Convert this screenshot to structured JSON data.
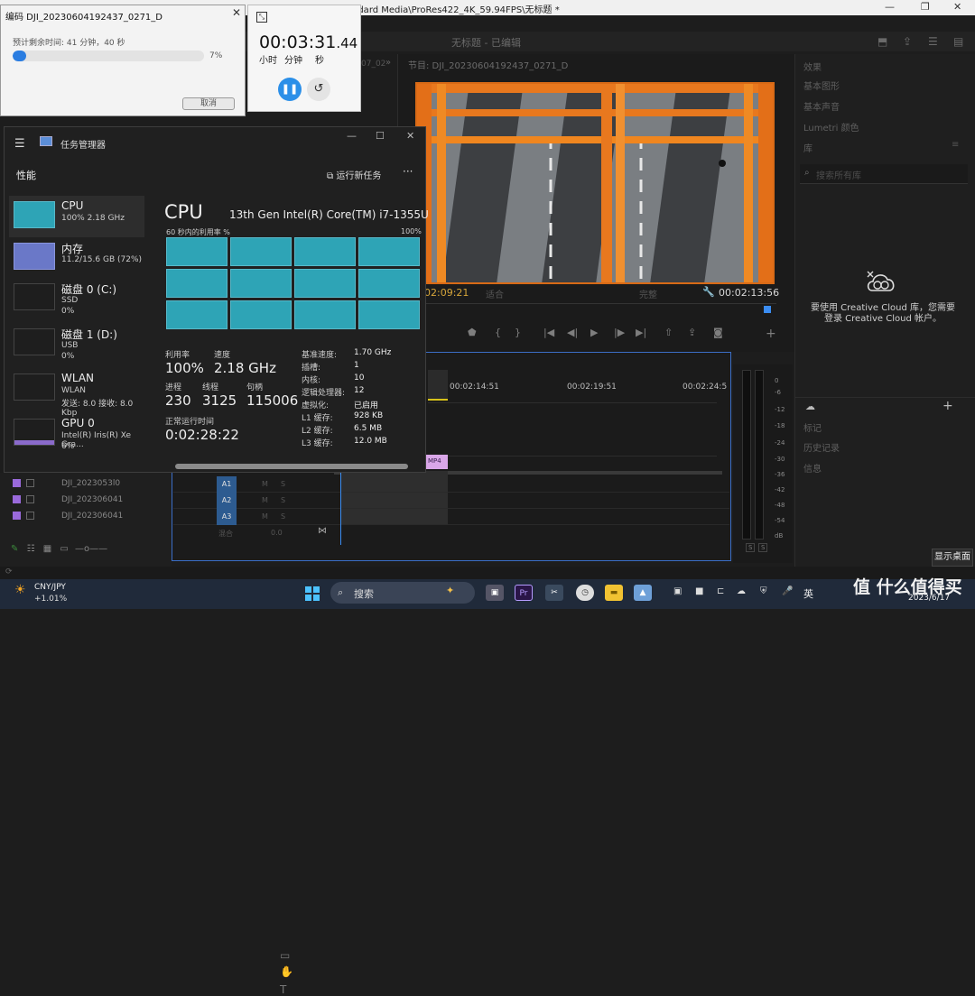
{
  "premiere": {
    "window_title": "ndard Media\\ProRes422_4K_59.94FPS\\无标题 *",
    "header_center": "无标题 - 已编辑",
    "source_label": "07_02",
    "program_label": "节目: DJI_20230604192437_0271_D",
    "timecode_left": "02:09:21",
    "timecode_right": "00:02:13:56",
    "fit_label": "适合",
    "full_label": "完整",
    "ruler": [
      "00:02:14:51",
      "00:02:19:51",
      "00:02:24:5"
    ],
    "clip_label": "MP4",
    "tracks": [
      {
        "label": "A1",
        "m": "M",
        "s": "S"
      },
      {
        "label": "A2",
        "m": "M",
        "s": "S"
      },
      {
        "label": "A3",
        "m": "M",
        "s": "S"
      }
    ],
    "mix_label": "混合",
    "mix_value": "0.0",
    "meter_scale": [
      "0",
      "-6",
      "-12",
      "-18",
      "-24",
      "-30",
      "-36",
      "-42",
      "-48",
      "-54",
      "dB"
    ],
    "meter_s": [
      "S",
      "S"
    ],
    "project_items": [
      "DJI_2023053l0",
      "DJI_202306041",
      "DJI_202306041"
    ],
    "right_panel": {
      "items": [
        "效果",
        "基本图形",
        "基本声音",
        "Lumetri 颜色",
        "库"
      ],
      "search_placeholder": "搜索所有库",
      "cc_message": "要使用 Creative Cloud 库，您需要登录 Creative Cloud 帐户。",
      "lower_items": [
        "标记",
        "历史记录",
        "信息"
      ]
    },
    "show_desktop": "显示桌面"
  },
  "encode": {
    "title": "编码 DJI_20230604192437_0271_D",
    "remaining": "预计剩余时间: 41 分钟，40 秒",
    "progress_pct": 7,
    "pct_label": "7%",
    "cancel": "取消"
  },
  "stopwatch": {
    "time": "00:03:31",
    "ms": ".44",
    "units": [
      "小时",
      "分钟",
      "秒"
    ]
  },
  "taskmgr": {
    "title": "任务管理器",
    "section": "性能",
    "run_task": "运行新任务",
    "sidebar": [
      {
        "name": "CPU",
        "sub1": "100%  2.18 GHz",
        "sub2": ""
      },
      {
        "name": "内存",
        "sub1": "11.2/15.6 GB (72%)",
        "sub2": ""
      },
      {
        "name": "磁盘 0 (C:)",
        "sub1": "SSD",
        "sub2": "0%"
      },
      {
        "name": "磁盘 1 (D:)",
        "sub1": "USB",
        "sub2": "0%"
      },
      {
        "name": "WLAN",
        "sub1": "WLAN",
        "sub2": "发送: 8.0  接收: 8.0 Kbp"
      },
      {
        "name": "GPU 0",
        "sub1": "Intel(R) Iris(R) Xe Gra...",
        "sub2": "6%"
      }
    ],
    "cpu_heading": "CPU",
    "cpu_model": "13th Gen Intel(R) Core(TM) i7-1355U",
    "util_label": "60 秒内的利用率 %",
    "util_max": "100%",
    "stats": {
      "util_lbl": "利用率",
      "util": "100%",
      "speed_lbl": "速度",
      "speed": "2.18 GHz",
      "proc_lbl": "进程",
      "proc": "230",
      "thread_lbl": "线程",
      "thread": "3125",
      "handle_lbl": "句柄",
      "handle": "115006",
      "uptime_lbl": "正常运行时间",
      "uptime": "0:02:28:22"
    },
    "specs": [
      {
        "k": "基准速度:",
        "v": "1.70 GHz"
      },
      {
        "k": "插槽:",
        "v": "1"
      },
      {
        "k": "内核:",
        "v": "10"
      },
      {
        "k": "逻辑处理器:",
        "v": "12"
      },
      {
        "k": "虚拟化:",
        "v": "已启用"
      },
      {
        "k": "L1 缓存:",
        "v": "928 KB"
      },
      {
        "k": "L2 缓存:",
        "v": "6.5 MB"
      },
      {
        "k": "L3 缓存:",
        "v": "12.0 MB"
      }
    ]
  },
  "taskbar": {
    "fx_name": "CNY/JPY",
    "fx_change": "+1.01%",
    "search": "搜索",
    "pr_label": "Pr",
    "ime": "英",
    "watermark": "值 什么值得买",
    "date": "2023/6/17"
  }
}
